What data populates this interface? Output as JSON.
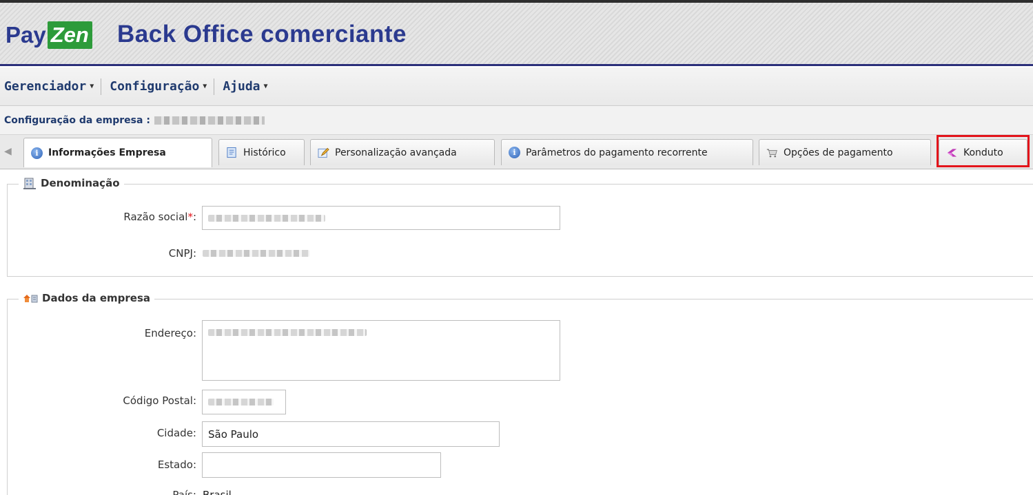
{
  "header": {
    "logo_pay": "Pay",
    "logo_zen": "Zen",
    "title": "Back Office comerciante"
  },
  "menu": {
    "items": [
      {
        "label": "Gerenciador"
      },
      {
        "label": "Configuração"
      },
      {
        "label": "Ajuda"
      }
    ]
  },
  "company_bar": {
    "label": "Configuração da empresa :"
  },
  "tabs": [
    {
      "label": "Informações Empresa",
      "icon": "info-icon",
      "active": true
    },
    {
      "label": "Histórico",
      "icon": "document-icon"
    },
    {
      "label": "Personalização avançada",
      "icon": "edit-icon"
    },
    {
      "label": "Parâmetros do pagamento recorrente",
      "icon": "info-icon"
    },
    {
      "label": "Opções de pagamento",
      "icon": "cart-icon"
    },
    {
      "label": "Konduto",
      "icon": "konduto-icon"
    }
  ],
  "denominacao": {
    "legend": "Denominação",
    "razao_label": "Razão social",
    "required_mark": "*",
    "colon": ":",
    "cnpj_label": "CNPJ:"
  },
  "dados": {
    "legend": "Dados da empresa",
    "endereco_label": "Endereço:",
    "cep_label": "Código Postal:",
    "cidade_label": "Cidade:",
    "cidade_value": "São Paulo",
    "estado_label": "Estado:",
    "estado_value": "",
    "pais_label": "País:",
    "pais_value": "Brasil"
  },
  "colors": {
    "brand_blue": "#2b3a8f",
    "brand_green": "#2d9b3a",
    "highlight_red": "#e3141b"
  }
}
